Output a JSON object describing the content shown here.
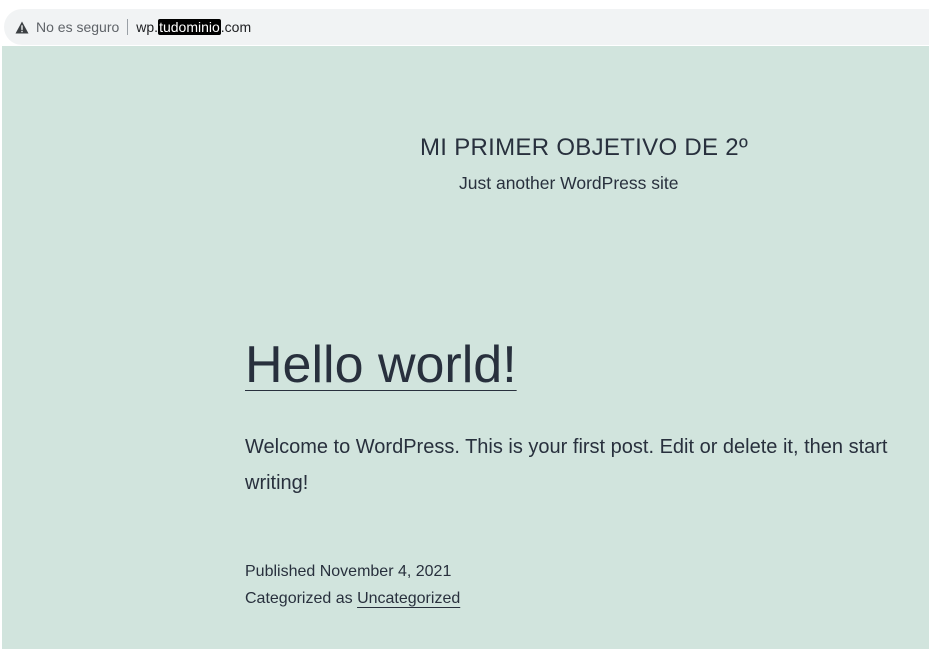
{
  "browser": {
    "security_label": "No es seguro",
    "url_prefix": "wp.",
    "url_redacted": "tudominio",
    "url_suffix": ".com"
  },
  "site": {
    "title": "MI PRIMER OBJETIVO DE 2º",
    "description": "Just another WordPress site",
    "background_color": "#d1e4dd",
    "text_color": "#28303d"
  },
  "post": {
    "title": "Hello world!",
    "excerpt": "Welcome to WordPress. This is your first post. Edit or delete it, then start writing!",
    "published": "Published November 4, 2021",
    "categorized_prefix": "Categorized as ",
    "category": "Uncategorized"
  },
  "icons": {
    "warning": "warning-triangle-icon"
  }
}
